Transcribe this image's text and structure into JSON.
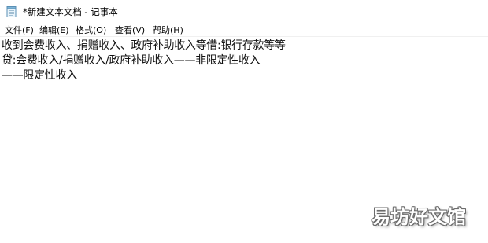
{
  "window": {
    "title": "*新建文本文档 - 记事本",
    "icon": "notepad-icon"
  },
  "menubar": {
    "items": [
      {
        "label": "文件(F)"
      },
      {
        "label": "编辑(E)"
      },
      {
        "label": "格式(O)"
      },
      {
        "label": "查看(V)"
      },
      {
        "label": "帮助(H)"
      }
    ]
  },
  "editor": {
    "lines": [
      "收到会费收入、捐赠收入、政府补助收入等借:银行存款等等",
      "贷:会费收入/捐赠收入/政府补助收入——非限定性收入",
      "——限定性收入"
    ]
  },
  "watermark": {
    "text": "易坊好文馆"
  }
}
